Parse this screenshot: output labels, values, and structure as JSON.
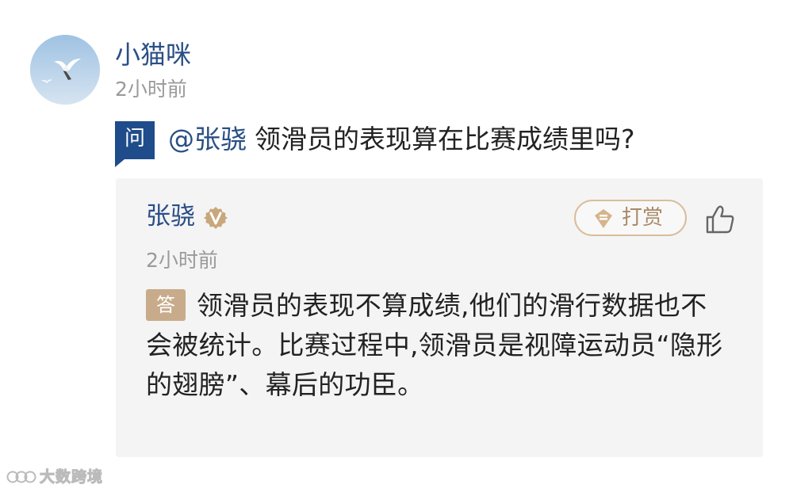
{
  "asker": {
    "name": "小猫咪",
    "time": "2小时前",
    "avatar_icon": "seagull-avatar"
  },
  "question": {
    "badge": "问",
    "mention": "@张骁",
    "text": "领滑员的表现算在比赛成绩里吗?"
  },
  "answer": {
    "author": "张骁",
    "verified_icon": "verified-v-badge",
    "time": "2小时前",
    "tip_label": "打赏",
    "tip_icon": "reward-coin-icon",
    "like_icon": "thumbs-up-icon",
    "badge": "答",
    "text": "领滑员的表现不算成绩,他们的滑行数据也不会被统计。比赛过程中,领滑员是视障运动员“隐形的翅膀”、幕后的功臣。"
  },
  "watermark": {
    "text": "大数跨境",
    "logo_icon": "watermark-logo"
  },
  "colors": {
    "link_blue": "#2a4f86",
    "question_badge": "#1f4c8a",
    "answer_badge": "#c8ab8a",
    "tip_border": "#d9bd9a",
    "tip_text": "#a88a68",
    "muted_text": "#9a9a9a",
    "card_background": "#f4f4f4"
  }
}
